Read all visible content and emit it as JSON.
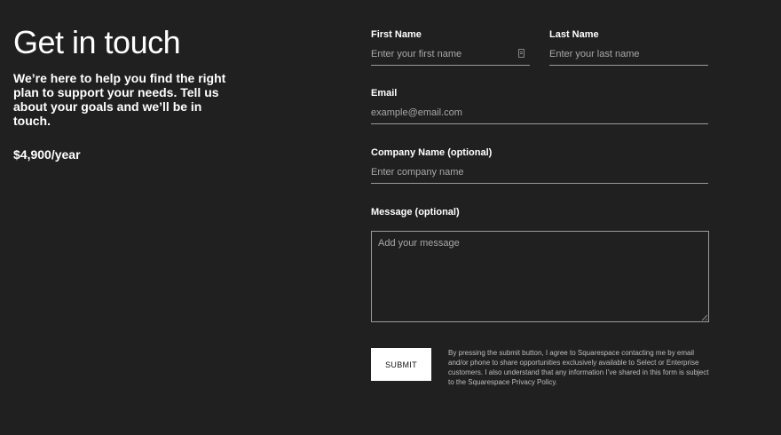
{
  "left": {
    "title": "Get in touch",
    "intro": "We’re here to help you find the right plan to support your needs. Tell us about your goals and we’ll be in touch.",
    "price": "$4,900/year"
  },
  "form": {
    "first_name": {
      "label": "First Name",
      "placeholder": "Enter your first name",
      "value": ""
    },
    "last_name": {
      "label": "Last Name",
      "placeholder": "Enter your last name",
      "value": ""
    },
    "email": {
      "label": "Email",
      "placeholder": "example@email.com",
      "value": ""
    },
    "company": {
      "label": "Company Name (optional)",
      "placeholder": "Enter company name",
      "value": ""
    },
    "message": {
      "label": "Message (optional)",
      "placeholder": "Add your message",
      "value": ""
    },
    "submit_label": "SUBMIT",
    "disclaimer": "By pressing the submit button, I agree to Squarespace contacting me by email and/or phone to share opportunities exclusively available to Select or Enterprise customers. I also understand that any information I’ve shared in this form is subject to the Squarespace Privacy Policy."
  },
  "icons": {
    "autofill": "contact-card-icon",
    "resize": "resize-handle-icon"
  },
  "colors": {
    "background": "#202020",
    "text": "#ffffff",
    "placeholder": "#a8a8a8",
    "border": "#9a9a9a",
    "button_bg": "#ffffff",
    "button_text": "#111111"
  }
}
